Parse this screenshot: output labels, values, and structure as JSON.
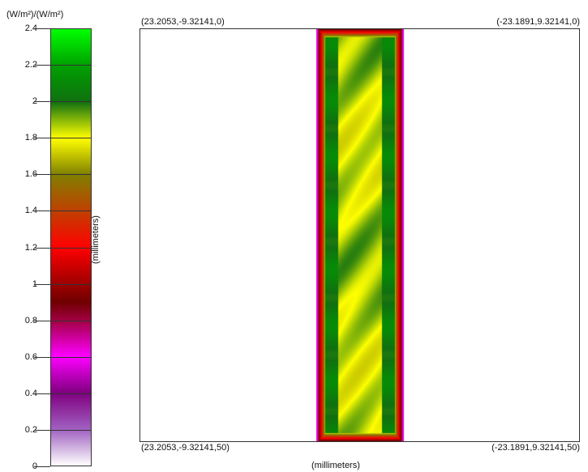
{
  "chart_data": {
    "type": "heatmap",
    "colorbar": {
      "unit_label": "(W/m²)/(W/m²)",
      "min": 0,
      "max": 2.4,
      "ticks": [
        "0",
        "0.2",
        "0.4",
        "0.6",
        "0.8",
        "1",
        "1.2",
        "1.4",
        "1.6",
        "1.8",
        "2",
        "2.2",
        "2.4"
      ],
      "tick_values": [
        0,
        0.2,
        0.4,
        0.6,
        0.8,
        1.0,
        1.2,
        1.4,
        1.6,
        1.8,
        2.0,
        2.2,
        2.4
      ],
      "color_stops": [
        {
          "value": 0.0,
          "color": "#ffffff"
        },
        {
          "value": 0.2,
          "color": "#a060c0"
        },
        {
          "value": 0.4,
          "color": "#800080"
        },
        {
          "value": 0.6,
          "color": "#ff00ff"
        },
        {
          "value": 0.8,
          "color": "#a00040"
        },
        {
          "value": 0.9,
          "color": "#700000"
        },
        {
          "value": 1.2,
          "color": "#ff0000"
        },
        {
          "value": 1.4,
          "color": "#c04000"
        },
        {
          "value": 1.6,
          "color": "#808000"
        },
        {
          "value": 1.8,
          "color": "#ffff00"
        },
        {
          "value": 2.0,
          "color": "#107010"
        },
        {
          "value": 2.2,
          "color": "#00a000"
        },
        {
          "value": 2.4,
          "color": "#00ff00"
        }
      ]
    },
    "y_axis_title": "(millimeters)",
    "x_axis_title": "(millimeters)",
    "corners": {
      "top_left": "(23.2053,-9.32141,0)",
      "top_right": "(-23.1891,9.32141,0)",
      "bottom_left": "(23.2053,-9.32141,50)",
      "bottom_right": "(-23.1891,9.32141,50)"
    },
    "field": {
      "x_range_mm": [
        -23.2,
        23.2
      ],
      "strip_x_mm": [
        -4.6,
        4.6
      ],
      "edge_value": 0.6,
      "rail_value": 2.05,
      "center_value": 1.85,
      "outside_value": 0.0
    }
  }
}
